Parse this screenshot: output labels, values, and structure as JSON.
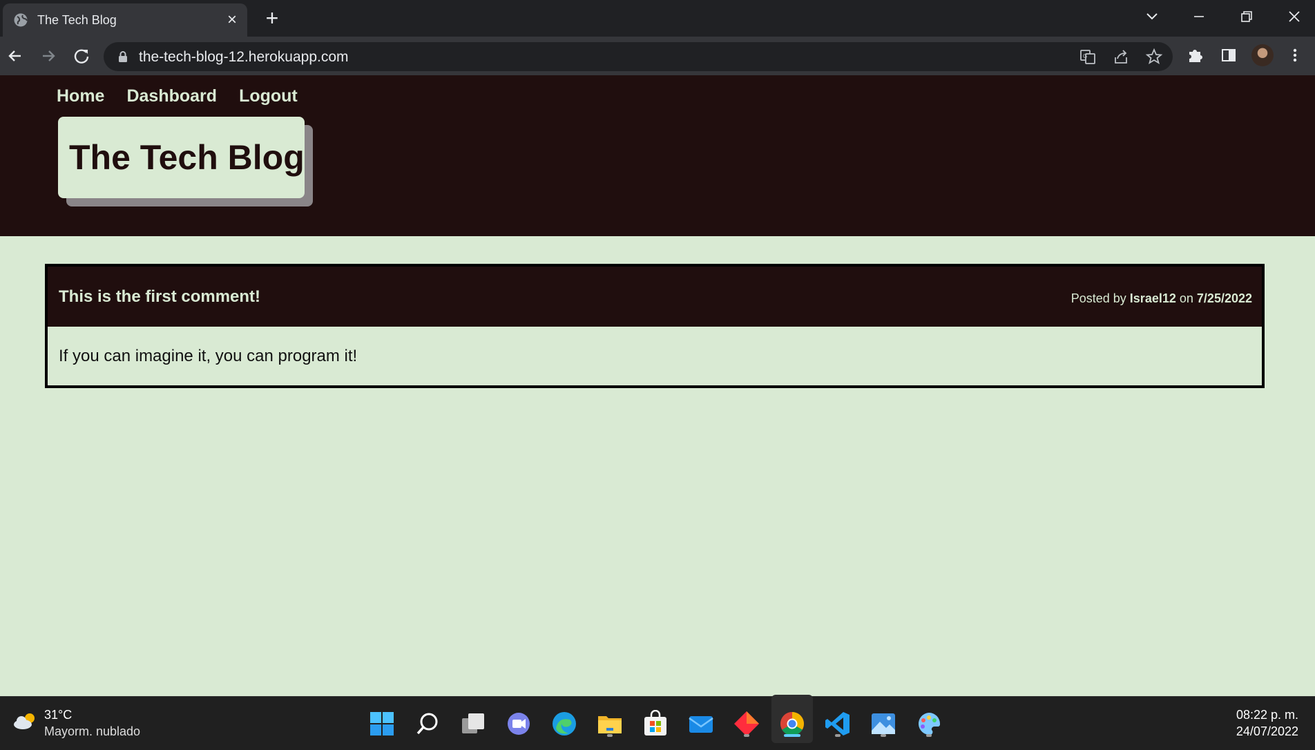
{
  "browser": {
    "tab_title": "The Tech Blog",
    "url": "the-tech-blog-12.herokuapp.com"
  },
  "site": {
    "nav": [
      "Home",
      "Dashboard",
      "Logout"
    ],
    "brand": "The Tech Blog",
    "colors": {
      "dark": "#200e0e",
      "light": "#d9ead3"
    }
  },
  "post": {
    "title": "This is the first comment!",
    "meta_prefix": "Posted by",
    "author": "Israel12",
    "meta_on": "on",
    "date": "7/25/2022",
    "body": "If you can imagine it, you can program it!"
  },
  "taskbar": {
    "weather_temp": "31°C",
    "weather_desc": "Mayorm. nublado",
    "time": "08:22 p. m.",
    "date": "24/07/2022",
    "apps": [
      "start-icon",
      "search-icon",
      "task-view-icon",
      "teams-chat-icon",
      "edge-icon",
      "file-explorer-icon",
      "store-icon",
      "mail-icon",
      "app-diamond-icon",
      "chrome-icon",
      "vscode-icon",
      "photos-icon",
      "paint-icon"
    ]
  }
}
